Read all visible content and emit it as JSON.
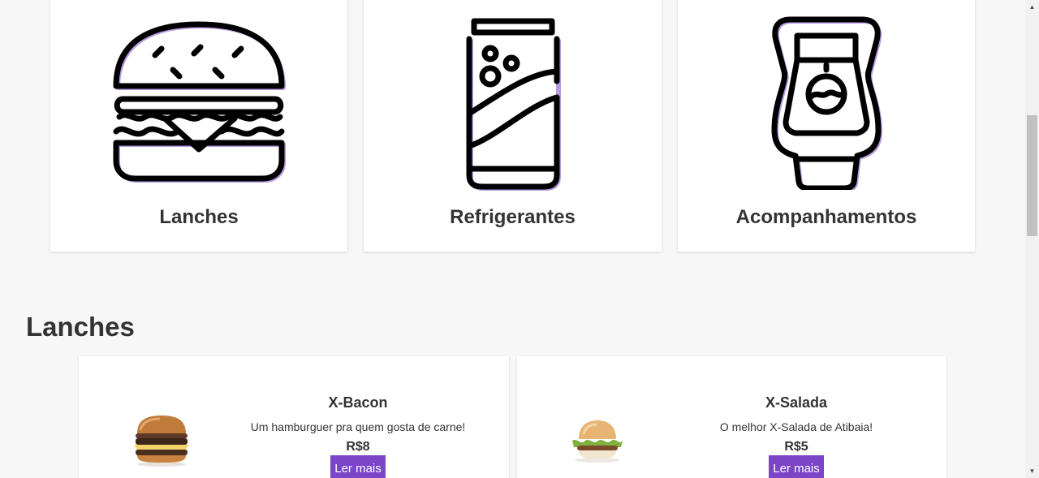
{
  "categories": [
    {
      "label": "Lanches",
      "icon": "burger-icon"
    },
    {
      "label": "Refrigerantes",
      "icon": "soda-can-icon"
    },
    {
      "label": "Acompanhamentos",
      "icon": "ketchup-bottle-icon"
    }
  ],
  "section": {
    "title": "Lanches"
  },
  "products": [
    {
      "name": "X-Bacon",
      "description": "Um hamburguer pra quem gosta de carne!",
      "price": "R$8",
      "button": "Ler mais",
      "image": "burger-photo"
    },
    {
      "name": "X-Salada",
      "description": "O melhor X-Salada de Atibaia!",
      "price": "R$5",
      "button": "Ler mais",
      "image": "burger-photo"
    }
  ],
  "colors": {
    "accent": "#7a45c7",
    "background": "#f7f7f7",
    "card": "#ffffff",
    "text": "#333333"
  }
}
